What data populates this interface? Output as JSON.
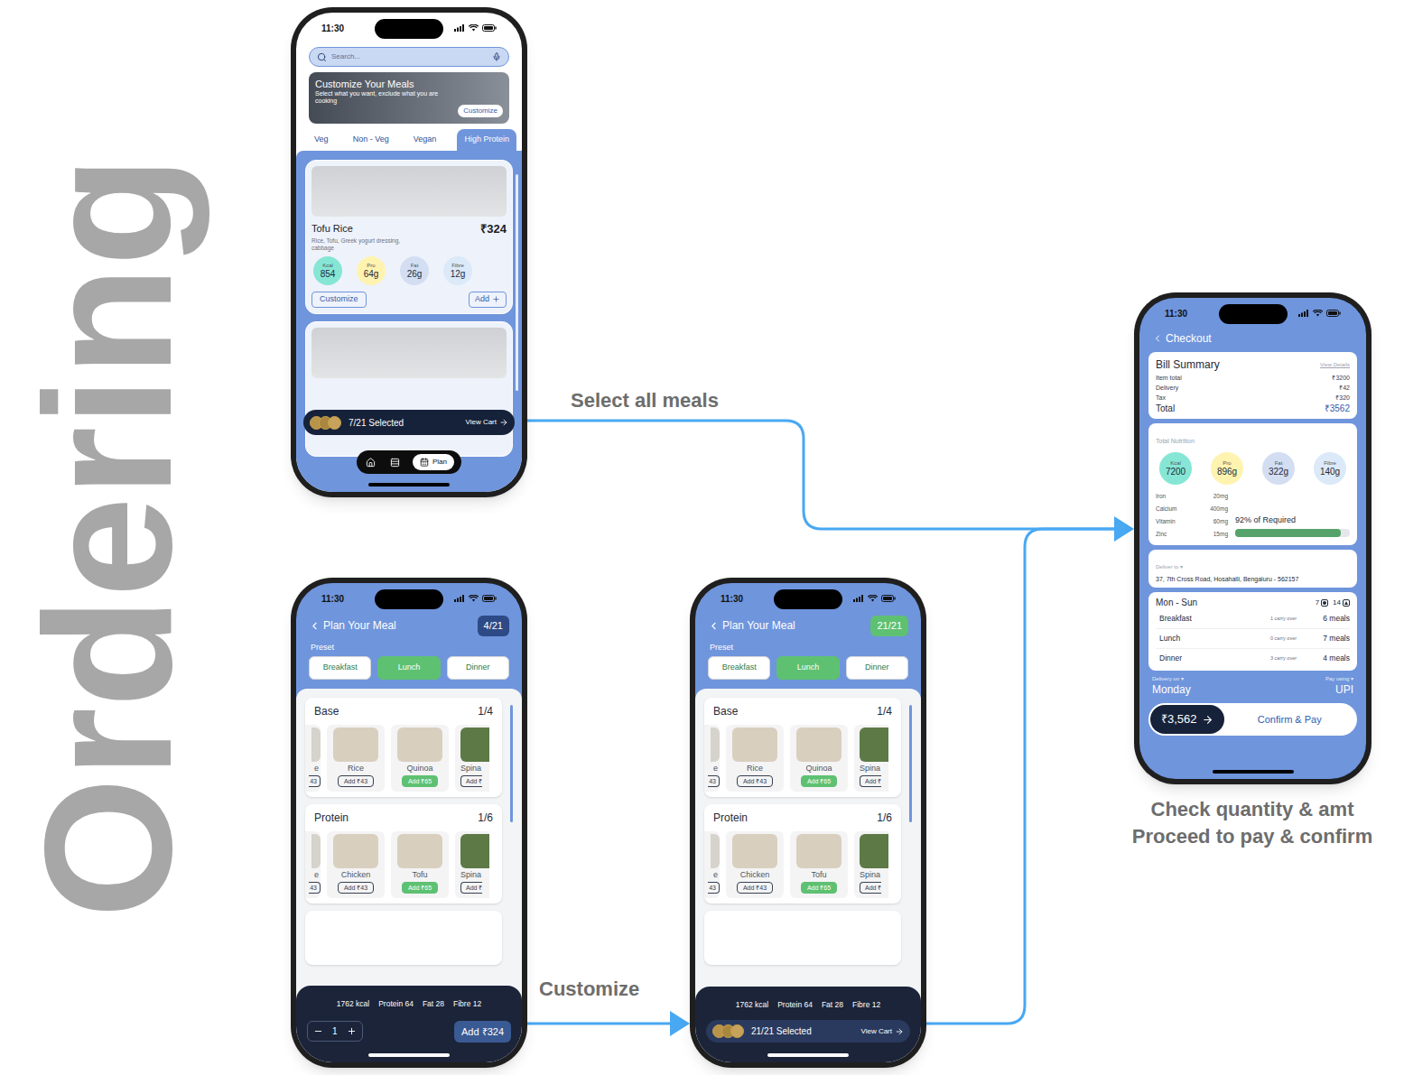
{
  "title": "Ordering",
  "flow_labels": {
    "select": "Select all meals",
    "customize": "Customize",
    "checkout": [
      "Check quantity & amt",
      "Proceed to pay & confirm"
    ]
  },
  "menu_screen": {
    "time": "11:30",
    "search_placeholder": "Search...",
    "banner": {
      "title": "Customize Your Meals",
      "subtitle": "Select what you want, exclude what you are cooking",
      "button": "Customize"
    },
    "tabs": [
      {
        "label": "Veg",
        "selected": false
      },
      {
        "label": "Non - Veg",
        "selected": false
      },
      {
        "label": "Vegan",
        "selected": false
      },
      {
        "label": "High Protein",
        "selected": true
      }
    ],
    "meal": {
      "name": "Tofu Rice",
      "price": "₹324",
      "description": "Rice, Tofu, Greek yogurt dressing, cabbage",
      "nutrition": [
        {
          "label": "Kcal",
          "value": "854",
          "color": "#86e6d5"
        },
        {
          "label": "Pro",
          "value": "64g",
          "color": "#fff3b0"
        },
        {
          "label": "Fat",
          "value": "26g",
          "color": "#d3def3"
        },
        {
          "label": "Fibre",
          "value": "12g",
          "color": "#dbe9f8"
        }
      ],
      "customize": "Customize",
      "add": "Add"
    },
    "cart": {
      "count": "7/21 Selected",
      "action": "View Cart"
    },
    "nav": [
      {
        "kind": "home",
        "selected": false
      },
      {
        "kind": "list",
        "selected": false
      },
      {
        "kind": "plan",
        "label": "Plan",
        "selected": true
      }
    ]
  },
  "plan_screens": [
    {
      "time": "11:30",
      "title": "Plan Your Meal",
      "progress": "4/21",
      "complete": false,
      "preset_label": "Preset",
      "presets": [
        {
          "label": "Breakfast",
          "selected": false
        },
        {
          "label": "Lunch",
          "selected": true
        },
        {
          "label": "Dinner",
          "selected": false
        }
      ],
      "sections": [
        {
          "title": "Base",
          "count": "1/4",
          "items": [
            {
              "kind": "cut-left",
              "name": "e",
              "button": "43",
              "selected": false
            },
            {
              "kind": "full",
              "name": "Rice",
              "button": "Add ₹43",
              "selected": false
            },
            {
              "kind": "full",
              "name": "Quinoa",
              "button": "Add ₹65",
              "selected": true
            },
            {
              "kind": "cut-right",
              "name": "Spina",
              "button": "Add ₹",
              "selected": false
            }
          ]
        },
        {
          "title": "Protein",
          "count": "1/6",
          "items": [
            {
              "kind": "cut-left",
              "name": "e",
              "button": "43",
              "selected": false
            },
            {
              "kind": "full",
              "name": "Chicken",
              "button": "Add ₹43",
              "selected": false
            },
            {
              "kind": "full",
              "name": "Tofu",
              "button": "Add ₹65",
              "selected": true
            },
            {
              "kind": "cut-right",
              "name": "Spina",
              "button": "Add ₹",
              "selected": false
            }
          ]
        }
      ],
      "totals": [
        "1762 kcal",
        "Protein 64",
        "Fat 28",
        "Fibre 12"
      ],
      "footer": {
        "kind": "stepper",
        "quantity": "1",
        "add": "Add ₹324"
      }
    },
    {
      "time": "11:30",
      "title": "Plan Your Meal",
      "progress": "21/21",
      "complete": true,
      "preset_label": "Preset",
      "presets": [
        {
          "label": "Breakfast",
          "selected": false
        },
        {
          "label": "Lunch",
          "selected": true
        },
        {
          "label": "Dinner",
          "selected": false
        }
      ],
      "sections": [
        {
          "title": "Base",
          "count": "1/4",
          "items": [
            {
              "kind": "cut-left",
              "name": "e",
              "button": "43",
              "selected": false
            },
            {
              "kind": "full",
              "name": "Rice",
              "button": "Add ₹43",
              "selected": false
            },
            {
              "kind": "full",
              "name": "Quinoa",
              "button": "Add ₹65",
              "selected": true
            },
            {
              "kind": "cut-right",
              "name": "Spina",
              "button": "Add ₹",
              "selected": false
            }
          ]
        },
        {
          "title": "Protein",
          "count": "1/6",
          "items": [
            {
              "kind": "cut-left",
              "name": "e",
              "button": "43",
              "selected": false
            },
            {
              "kind": "full",
              "name": "Chicken",
              "button": "Add ₹43",
              "selected": false
            },
            {
              "kind": "full",
              "name": "Tofu",
              "button": "Add ₹65",
              "selected": true
            },
            {
              "kind": "cut-right",
              "name": "Spina",
              "button": "Add ₹",
              "selected": false
            }
          ]
        }
      ],
      "totals": [
        "1762 kcal",
        "Protein 64",
        "Fat 28",
        "Fibre 12"
      ],
      "footer": {
        "kind": "cart",
        "count": "21/21 Selected",
        "action": "View Cart"
      }
    }
  ],
  "checkout": {
    "time": "11:30",
    "title": "Checkout",
    "bill": {
      "title": "Bill Summary",
      "details": "View Details",
      "rows": [
        {
          "label": "Item total",
          "value": "₹3200"
        },
        {
          "label": "Delivery",
          "value": "₹42"
        },
        {
          "label": "Tax",
          "value": "₹320"
        }
      ],
      "total_label": "Total",
      "total_value": "₹3562"
    },
    "nutrition": {
      "title": "Total Nutrition",
      "items": [
        {
          "label": "Kcal",
          "value": "7200",
          "color": "#86e6d5"
        },
        {
          "label": "Pro",
          "value": "896g",
          "color": "#fff3b0"
        },
        {
          "label": "Fat",
          "value": "322g",
          "color": "#d3def3"
        },
        {
          "label": "Fibre",
          "value": "140g",
          "color": "#dbe9f8"
        }
      ],
      "micros": [
        {
          "name": "Iron",
          "value": "20mg"
        },
        {
          "name": "Calcium",
          "value": "400mg"
        },
        {
          "name": "Vitamin",
          "value": "60mg"
        },
        {
          "name": "Zinc",
          "value": "15mg"
        }
      ],
      "required": "92% of Required",
      "level": 0.92
    },
    "deliver": {
      "label": "Deliver to",
      "caret": "▾",
      "address": "37, 7th Cross Road, Hosahalli, Bengaluru - 562157"
    },
    "schedule": {
      "title": "Mon - Sun",
      "veg": "7",
      "nonveg": "14",
      "rows": [
        {
          "meal": "Breakfast",
          "carry": "1 carry over",
          "count": "6 meals"
        },
        {
          "meal": "Lunch",
          "carry": "0 carry over",
          "count": "7 meals"
        },
        {
          "meal": "Dinner",
          "carry": "3 carry over",
          "count": "4 meals"
        }
      ]
    },
    "delivery_on": {
      "label": "Delivery on",
      "caret": "▾",
      "value": "Monday"
    },
    "pay_using": {
      "label": "Pay using",
      "caret": "▾",
      "value": "UPI"
    },
    "pay": {
      "amount": "₹3,562",
      "action": "Confirm & Pay"
    }
  }
}
